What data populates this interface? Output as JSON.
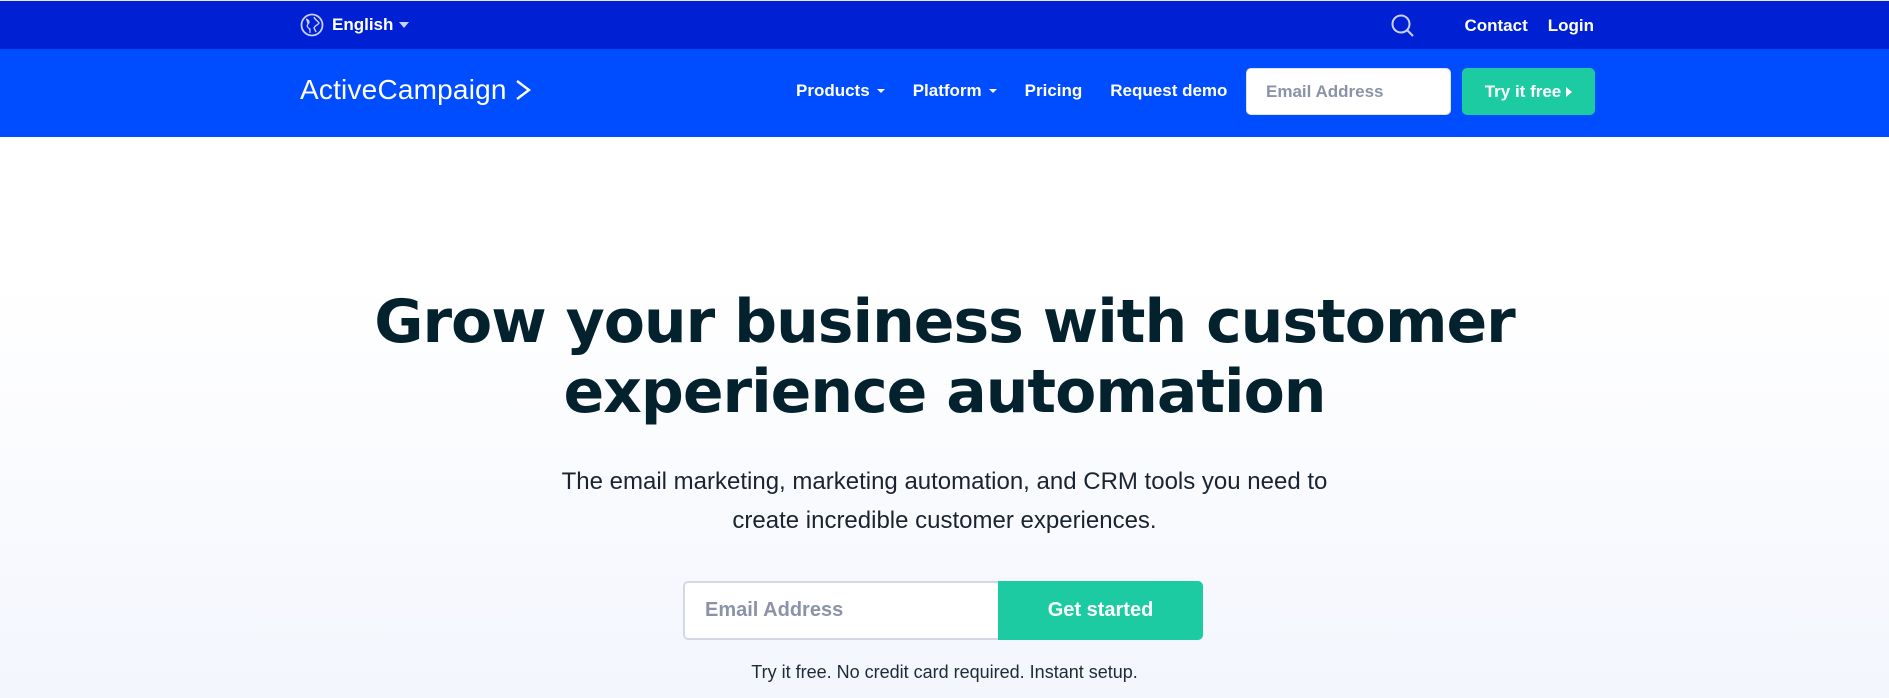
{
  "topbar": {
    "language_label": "English",
    "language_icon": "globe-icon",
    "search_icon": "search-icon",
    "links": [
      {
        "label": "Contact"
      },
      {
        "label": "Login"
      }
    ]
  },
  "navbar": {
    "logo_text": "ActiveCampaign",
    "logo_icon": "chevron-right-icon",
    "items": [
      {
        "label": "Products",
        "has_dropdown": true
      },
      {
        "label": "Platform",
        "has_dropdown": true
      },
      {
        "label": "Pricing",
        "has_dropdown": false
      },
      {
        "label": "Request demo",
        "has_dropdown": false
      }
    ],
    "email_placeholder": "Email Address",
    "email_value": "",
    "try_button_label": "Try it free"
  },
  "hero": {
    "title_line1": "Grow your business with customer",
    "title_line2": "experience automation",
    "subtitle_line1": "The email marketing, marketing automation, and CRM tools you need to",
    "subtitle_line2": "create incredible customer experiences.",
    "email_placeholder": "Email Address",
    "email_value": "",
    "cta_label": "Get started",
    "note": "Try it free. No credit card required. Instant setup."
  },
  "colors": {
    "topbar_bg": "#0020d4",
    "navbar_bg": "#004cff",
    "accent_green": "#1ccba2",
    "heading_text": "#04212e"
  }
}
